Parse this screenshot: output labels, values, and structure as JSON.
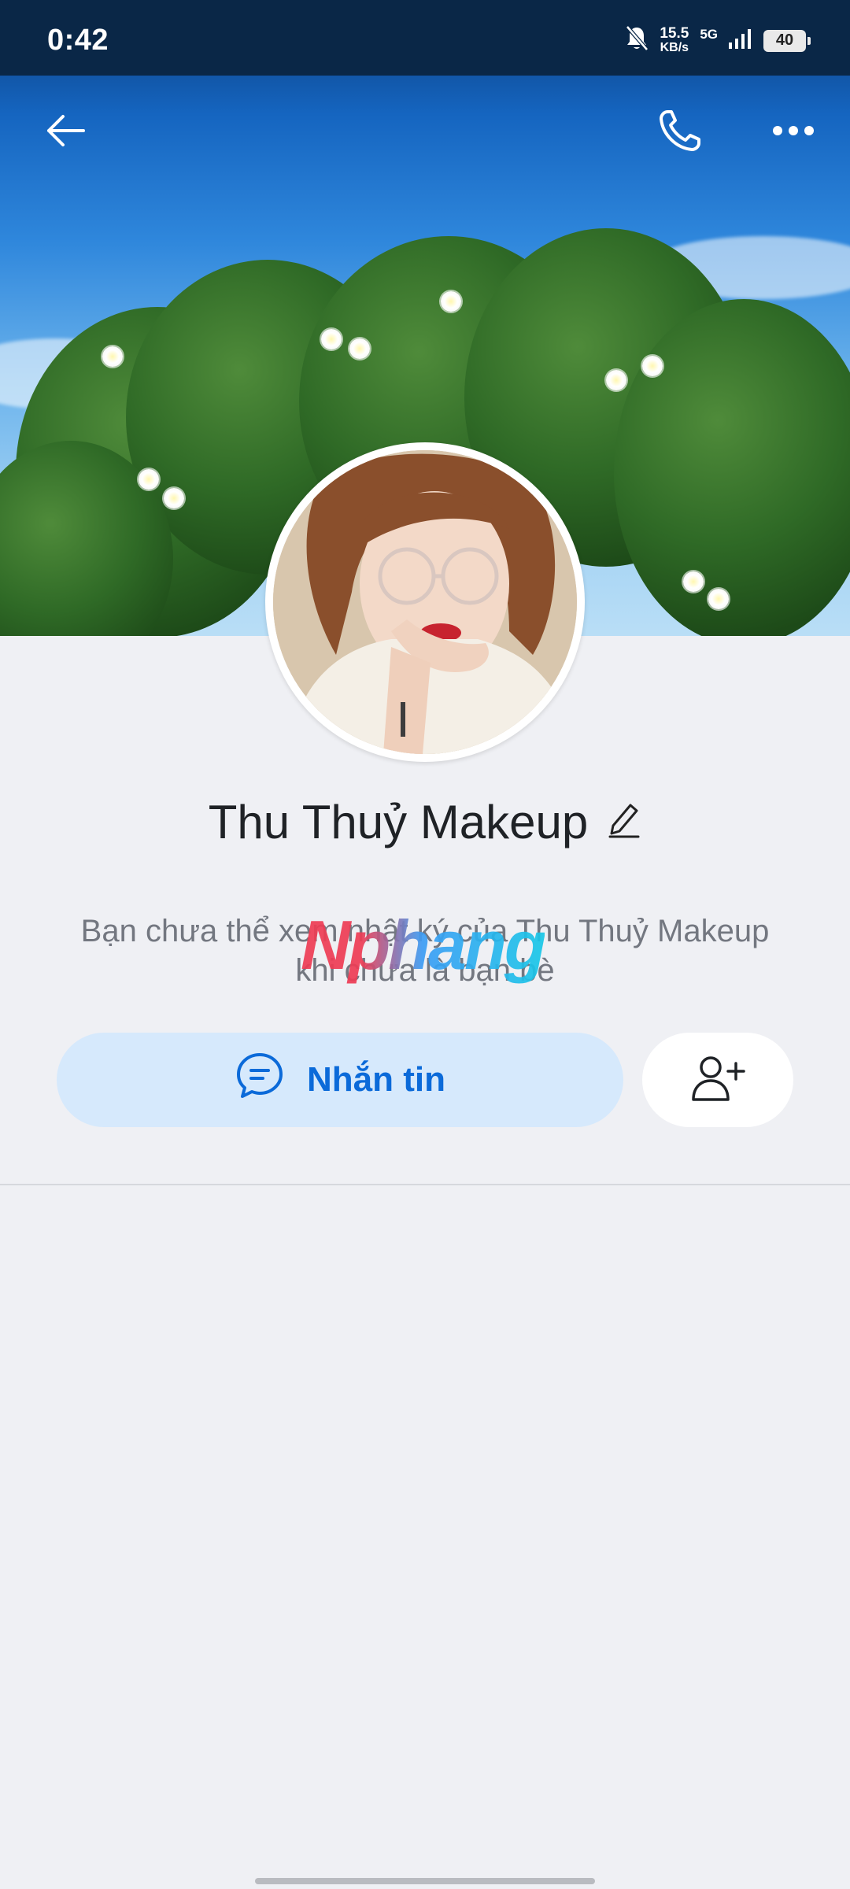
{
  "status_bar": {
    "time": "0:42",
    "speed_value": "15.5",
    "speed_unit": "KB/s",
    "network": "5G",
    "battery": "40",
    "icons": [
      "bell-muted-icon",
      "signal-icon",
      "battery-icon"
    ]
  },
  "header": {
    "icons": [
      "back-arrow-icon",
      "phone-icon",
      "more-icon"
    ]
  },
  "profile": {
    "name": "Thu Thuỷ Makeup",
    "info_line_1": "Bạn chưa thể xem nhật ký của Thu Thuỷ Makeup",
    "info_line_2": "khi chưa là bạn bè"
  },
  "watermark": {
    "text": "Nphang"
  },
  "actions": {
    "message_label": "Nhắn tin",
    "message_icon": "chat-bubble-icon",
    "add_friend_icon": "add-user-icon"
  },
  "colors": {
    "accent": "#0b6ad9",
    "message_button_bg": "#d6e9fc",
    "page_bg": "#eff0f4"
  }
}
